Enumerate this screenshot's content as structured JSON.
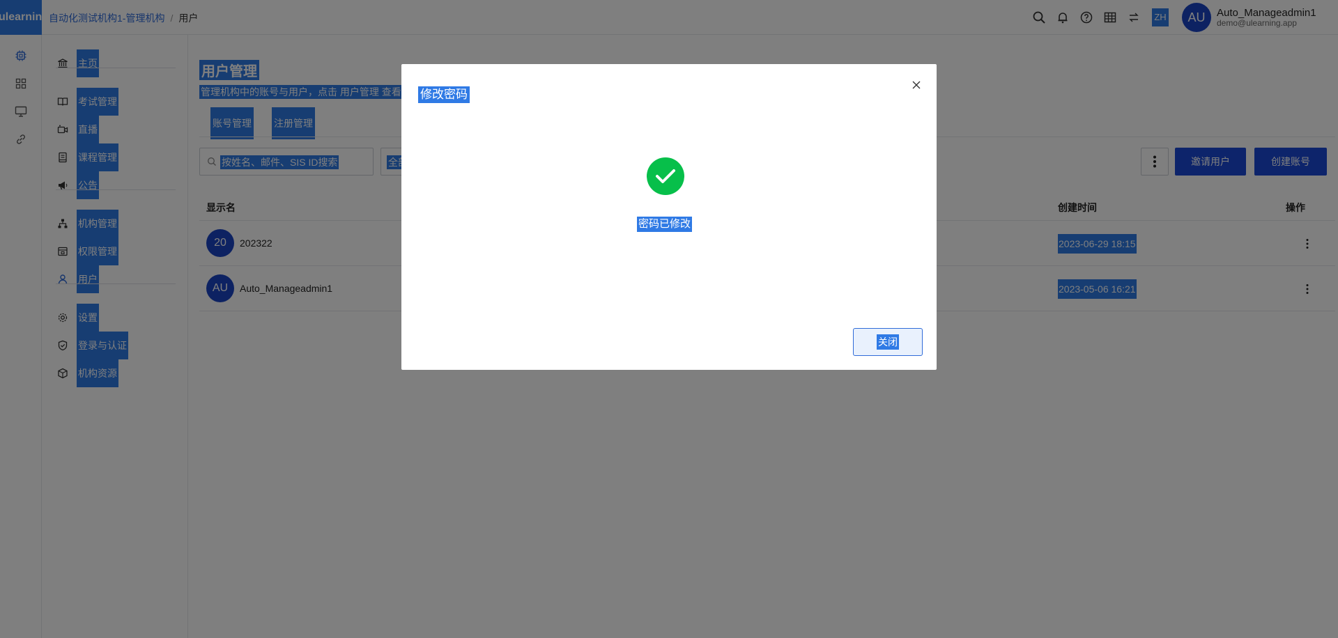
{
  "topbar": {
    "logo": "ulearning",
    "breadcrumb": {
      "org": "自动化测试机构1-管理机构",
      "separator": "/",
      "current": "用户"
    },
    "language": "ZH",
    "user": {
      "avatar": "AU",
      "name": "Auto_Manageadmin1",
      "email": "demo@ulearning.app"
    },
    "icons": [
      "search-icon",
      "bell-icon",
      "help-icon",
      "grid-icon",
      "switch-icon"
    ]
  },
  "rail": {
    "icons": [
      "chip-icon",
      "apps-icon",
      "monitor-icon",
      "link-icon"
    ]
  },
  "sidebar": {
    "items": [
      {
        "label": "主页",
        "icon": "bank-icon"
      },
      {
        "label": "考试管理",
        "icon": "book-icon"
      },
      {
        "label": "直播",
        "icon": "camera-icon"
      },
      {
        "label": "课程管理",
        "icon": "course-icon"
      },
      {
        "label": "公告",
        "icon": "megaphone-icon"
      },
      {
        "label": "机构管理",
        "icon": "org-tree-icon"
      },
      {
        "label": "权限管理",
        "icon": "permission-icon"
      },
      {
        "label": "用户",
        "icon": "user-icon"
      },
      {
        "label": "设置",
        "icon": "gear-icon"
      },
      {
        "label": "登录与认证",
        "icon": "shield-icon"
      },
      {
        "label": "机构资源",
        "icon": "box-icon"
      }
    ]
  },
  "main": {
    "title": "用户管理",
    "description": "管理机构中的账号与用户，点击 用户管理 查看",
    "tabs": [
      "账号管理",
      "注册管理"
    ],
    "search_placeholder": "按姓名、邮件、SIS ID搜索",
    "filter_value": "全部",
    "buttons": {
      "invite": "邀请用户",
      "create": "创建账号"
    },
    "columns": {
      "display_name": "显示名",
      "created": "创建时间",
      "actions": "操作"
    },
    "rows": [
      {
        "avatar": "20",
        "name": "202322",
        "created": "2023-06-29 18:15"
      },
      {
        "avatar": "AU",
        "name": "Auto_Manageadmin1",
        "created": "2023-05-06 16:21"
      }
    ]
  },
  "modal": {
    "title": "修改密码",
    "message": "密码已修改",
    "close_button": "关闭"
  },
  "colors": {
    "accent": "#1a49d6",
    "selection": "#2f7ae5",
    "success": "#07bf4a"
  }
}
